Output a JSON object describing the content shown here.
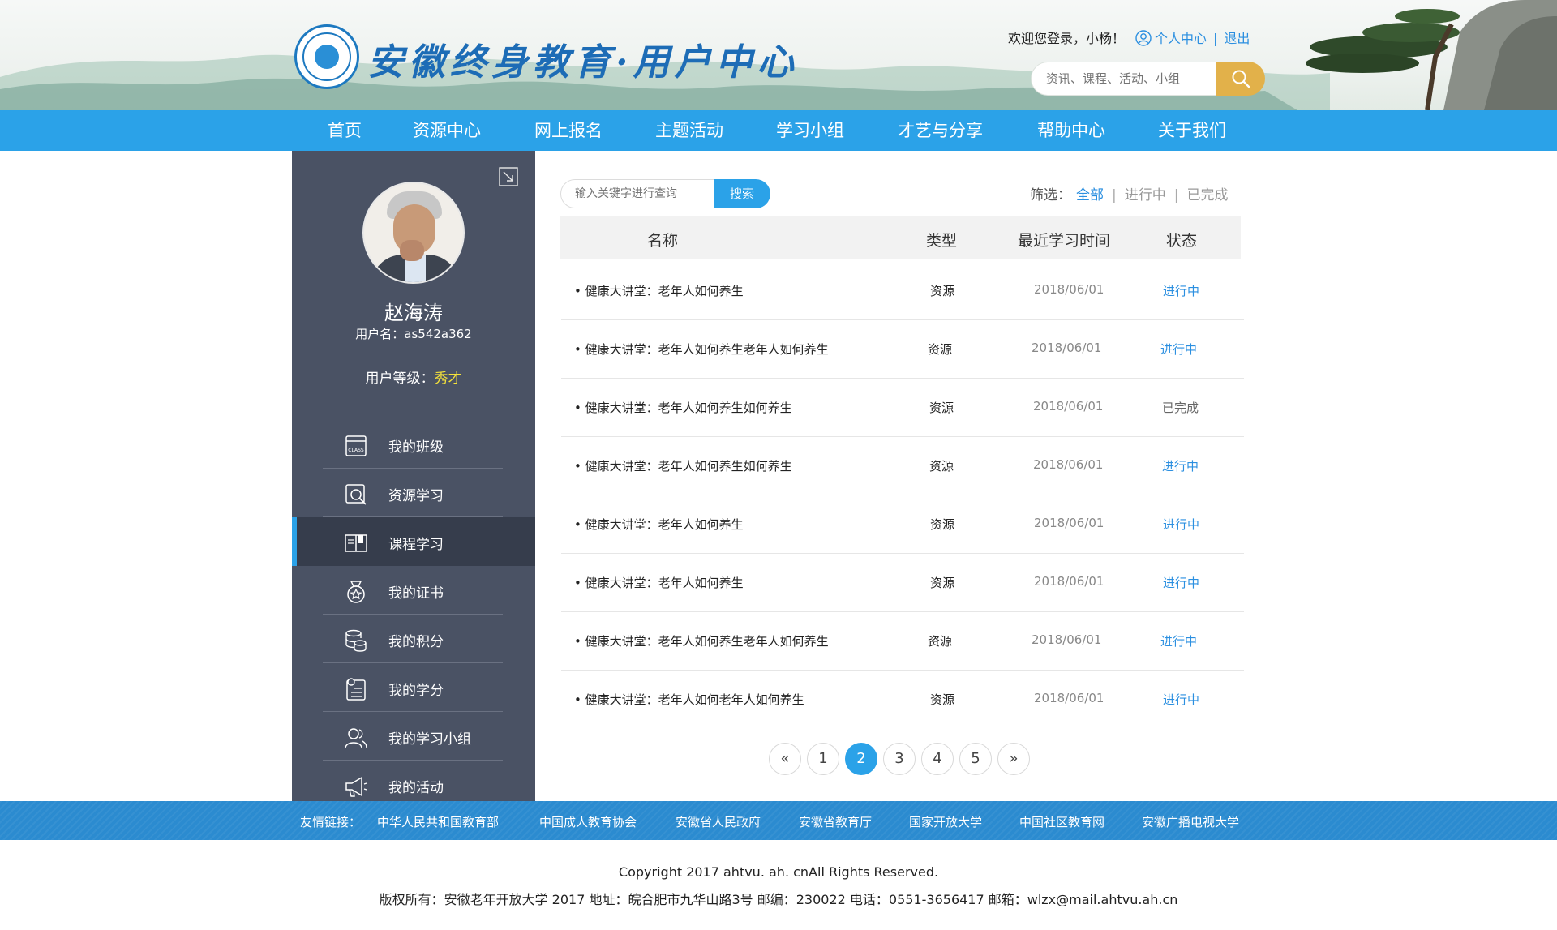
{
  "header": {
    "site_title": "安徽终身教育·用户中心",
    "welcome": "欢迎您登录，小杨！",
    "personal_center": "个人中心",
    "separator": "|",
    "logout": "退出",
    "search_placeholder": "资讯、课程、活动、小组",
    "search_icon": "search-icon"
  },
  "nav": {
    "items": [
      "首页",
      "资源中心",
      "网上报名",
      "主题活动",
      "学习小组",
      "才艺与分享",
      "帮助中心",
      "关于我们"
    ]
  },
  "sidebar": {
    "name": "赵海涛",
    "username": "用户名：as542a362",
    "level_label": "用户等级：",
    "level_value": "秀才",
    "menu": [
      {
        "label": "我的班级",
        "icon": "class-icon"
      },
      {
        "label": "资源学习",
        "icon": "resource-search-icon"
      },
      {
        "label": "课程学习",
        "icon": "book-icon",
        "active": true
      },
      {
        "label": "我的证书",
        "icon": "medal-icon"
      },
      {
        "label": "我的积分",
        "icon": "coins-icon"
      },
      {
        "label": "我的学分",
        "icon": "credit-icon"
      },
      {
        "label": "我的学习小组",
        "icon": "group-icon"
      },
      {
        "label": "我的活动",
        "icon": "megaphone-icon"
      }
    ]
  },
  "main": {
    "search_placeholder": "输入关键字进行查询",
    "search_button": "搜索",
    "filter_label": "筛选：",
    "filter_all": "全部",
    "filter_ongoing": "进行中",
    "filter_done": "已完成",
    "filter_sep": "|",
    "columns": [
      "名称",
      "类型",
      "最近学习时间",
      "状态"
    ],
    "rows": [
      {
        "name": "• 健康大讲堂：老年人如何养生",
        "type": "资源",
        "date": "2018/06/01",
        "status": "进行中",
        "status_color": "#2b8fe0"
      },
      {
        "name": "• 健康大讲堂：老年人如何养生老年人如何养生",
        "type": "资源",
        "date": "2018/06/01",
        "status": "进行中",
        "status_color": "#2b8fe0"
      },
      {
        "name": "• 健康大讲堂：老年人如何养生如何养生",
        "type": "资源",
        "date": "2018/06/01",
        "status": "已完成",
        "status_color": "#666666"
      },
      {
        "name": "• 健康大讲堂：老年人如何养生如何养生",
        "type": "资源",
        "date": "2018/06/01",
        "status": "进行中",
        "status_color": "#2b8fe0"
      },
      {
        "name": "• 健康大讲堂：老年人如何养生",
        "type": "资源",
        "date": "2018/06/01",
        "status": "进行中",
        "status_color": "#2b8fe0"
      },
      {
        "name": "• 健康大讲堂：老年人如何养生",
        "type": "资源",
        "date": "2018/06/01",
        "status": "进行中",
        "status_color": "#2b8fe0"
      },
      {
        "name": "• 健康大讲堂：老年人如何养生老年人如何养生",
        "type": "资源",
        "date": "2018/06/01",
        "status": "进行中",
        "status_color": "#2b8fe0"
      },
      {
        "name": "• 健康大讲堂：老年人如何老年人如何养生",
        "type": "资源",
        "date": "2018/06/01",
        "status": "进行中",
        "status_color": "#2b8fe0"
      }
    ],
    "pagination": {
      "prev": "«",
      "pages": [
        "1",
        "2",
        "3",
        "4",
        "5"
      ],
      "current": "2",
      "next": "»"
    }
  },
  "footer": {
    "friend_label": "友情链接：",
    "links": [
      "中华人民共和国教育部",
      "中国成人教育协会",
      "安徽省人民政府",
      "安徽省教育厅",
      "国家开放大学",
      "中国社区教育网",
      "安徽广播电视大学"
    ],
    "copyright": "Copyright 2017 ahtvu. ah. cnAll Rights Reserved.",
    "address": "版权所有：安徽老年开放大学 2017 地址：皖合肥市九华山路3号 邮编：230022 电话：0551-3656417 邮箱：wlzx@mail.ahtvu.ah.cn"
  },
  "colors": {
    "accent_blue": "#2ba2e8",
    "sidebar_bg": "#4a5264",
    "sidebar_active": "#363d4c",
    "level_yellow": "#f5e23a",
    "search_gold": "#e2b14a"
  }
}
